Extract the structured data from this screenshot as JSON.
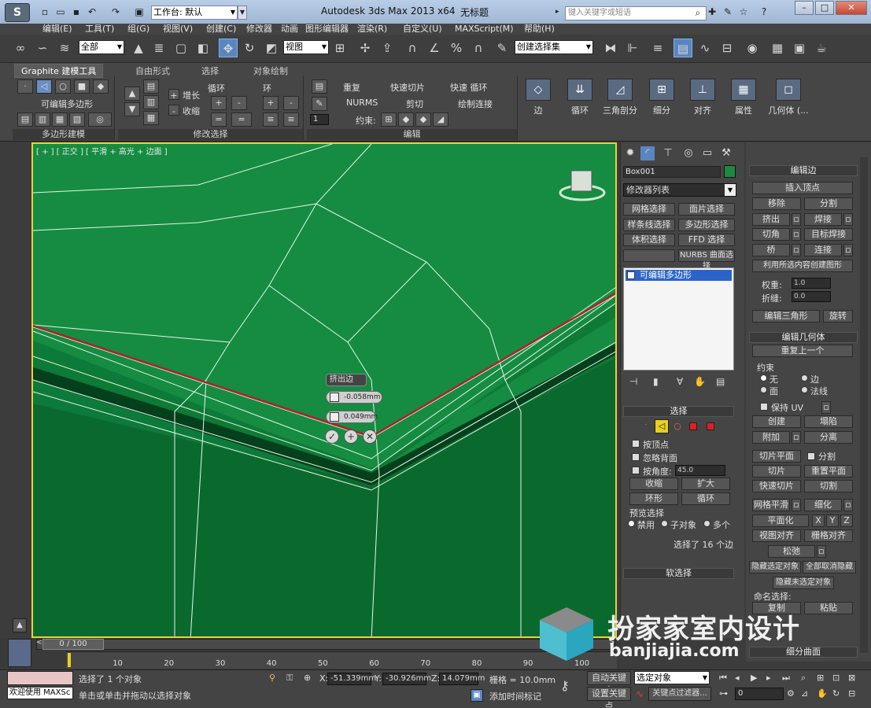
{
  "title_bar": {
    "workspace_label": "工作台: 默认",
    "app_title": "Autodesk 3ds Max  2013 x64",
    "doc_title": "无标题",
    "search_placeholder": "键入关键字或短语"
  },
  "menu": [
    "编辑(E)",
    "工具(T)",
    "组(G)",
    "视图(V)",
    "创建(C)",
    "修改器",
    "动画",
    "图形编辑器",
    "渲染(R)",
    "自定义(U)",
    "MAXScript(M)",
    "帮助(H)"
  ],
  "toolbar": {
    "selection_filter": "全部",
    "ref_coord": "视图",
    "named_selection": "创建选择集"
  },
  "ribbon": {
    "tabs": [
      "Graphite 建模工具",
      "自由形式",
      "选择",
      "对象绘制"
    ],
    "panel_poly": {
      "label": "可编辑多边形",
      "footer": "多边形建模"
    },
    "panel_modsel": {
      "grow": "增长",
      "shrink": "收缩",
      "loop": "循环",
      "ring": "环",
      "footer": "修改选择"
    },
    "panel_edit": {
      "repeat": "重复",
      "quickslice": "快速切片",
      "quickloop": "快速 循环",
      "nurms": "NURMS",
      "cut": "剪切",
      "swiftloop": "绘制连接",
      "constraint": "约束:",
      "spinner_val": "1",
      "footer": "编辑"
    },
    "big_buttons": [
      "边",
      "循环",
      "三角剖分",
      "细分",
      "对齐",
      "属性",
      "几何体 (..."
    ]
  },
  "viewport": {
    "label": "[ + ] [ 正交 ] [ 平滑 + 高光 + 边面 ]",
    "caddy": {
      "title": "挤出边",
      "height": "-0.058mm",
      "width": "0.049mm"
    }
  },
  "command_panel": {
    "object_name": "Box001",
    "modifier_list": "修改器列表",
    "mod_buttons": [
      "网格选择",
      "面片选择",
      "样条线选择",
      "多边形选择",
      "体积选择",
      "FFD 选择",
      "",
      "NURBS 曲面选择"
    ],
    "stack_item": "可编辑多边形",
    "selection": {
      "title": "选择",
      "by_vertex": "按顶点",
      "ignore_back": "忽略背面",
      "by_angle": "按角度:",
      "angle_value": "45.0",
      "shrink": "收缩",
      "grow": "扩大",
      "ring": "环形",
      "loop": "循环",
      "preview_title": "预览选择",
      "disabled": "禁用",
      "subobj": "子对象",
      "multi": "多个",
      "status": "选择了 16 个边"
    },
    "soft_sel": "软选择"
  },
  "right_panel": {
    "edit_edges_title": "编辑边",
    "insert_vertex": "插入顶点",
    "remove": "移除",
    "split": "分割",
    "extrude": "挤出",
    "weld": "焊接",
    "chamfer": "切角",
    "target_weld": "目标焊接",
    "bridge": "桥",
    "connect": "连接",
    "create_shape": "利用所选内容创建图形",
    "weight_label": "权重:",
    "weight_val": "1.0",
    "crease_label": "折缝:",
    "crease_val": "0.0",
    "edit_tri": "编辑三角形",
    "turn": "旋转",
    "edit_geo_title": "编辑几何体",
    "repeat_last": "重复上一个",
    "constraints_label": "约束",
    "c_none": "无",
    "c_edge": "边",
    "c_face": "面",
    "c_normal": "法线",
    "preserve_uv": "保持 UV",
    "create": "创建",
    "collapse": "塌陷",
    "attach": "附加",
    "detach": "分离",
    "slice_plane": "切片平面",
    "split2": "分割",
    "slice": "切片",
    "reset_plane": "重置平面",
    "quickslice": "快速切片",
    "cut": "切割",
    "meshsmooth": "网格平滑",
    "tessellate": "细化",
    "make_planar": "平面化",
    "x": "X",
    "y": "Y",
    "z": "Z",
    "view_align": "视图对齐",
    "grid_align": "栅格对齐",
    "relax": "松弛",
    "hide_sel": "隐藏选定对象",
    "unhide_all": "全部取消隐藏",
    "hide_unsel": "隐藏未选定对象",
    "named_sel": "命名选择:",
    "copy": "复制",
    "paste": "粘贴",
    "subdiv_title": "细分曲面"
  },
  "timeline": {
    "frame": "0 / 100",
    "ticks": [
      "10",
      "20",
      "30",
      "40",
      "50",
      "60",
      "70",
      "80",
      "90",
      "100"
    ]
  },
  "status": {
    "welcome": "欢迎使用 MAXSc",
    "msg1": "选择了 1 个对象",
    "msg2": "单击或单击并拖动以选择对象",
    "x_label": "X:",
    "x": "-51.339mm",
    "y_label": "Y:",
    "y": "-30.926mm",
    "z_label": "Z:",
    "z": "14.079mm",
    "grid": "栅格 = 10.0mm",
    "add_time_tag": "添加时间标记",
    "auto_key": "自动关键点",
    "set_key": "设置关键点",
    "sel_obj": "选定对象",
    "key_filter": "关键点过滤器...",
    "frame_field": "0"
  },
  "watermark": {
    "text": "扮家家室内设计",
    "url": "banjiajia.com"
  },
  "colors": {
    "viewport_green": "#0c7a3a",
    "selected_edge": "#b0202a",
    "accent": "#2a64c8"
  }
}
